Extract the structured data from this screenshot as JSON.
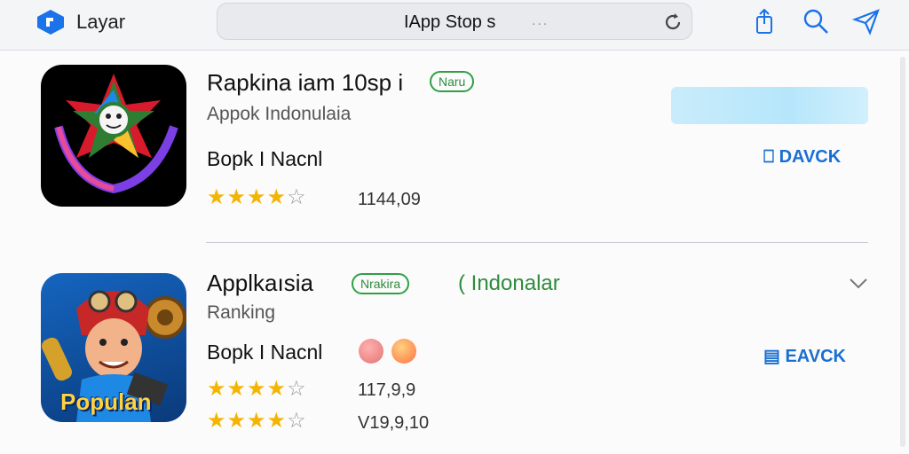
{
  "header": {
    "brand": "Layar",
    "address_title": "IApp Stop s",
    "address_dots": "...",
    "icons": [
      "layar-logo-icon",
      "reload-icon",
      "share-icon",
      "search-icon",
      "send-icon"
    ]
  },
  "apps": [
    {
      "name": "Rapkina iam 10sp i",
      "badge": "Naru",
      "subtitle": "Appok Indonulaia",
      "category": "Bopk I Nacnl",
      "rating_stars": 4,
      "rating_max": 5,
      "reviews": "1144,09",
      "action_label": "DAVCK"
    },
    {
      "name": "Applkaısia",
      "badge": "Nrakira",
      "developer": "( Indonalar",
      "subtitle": "Ranking",
      "category": "Bopk I Nacnl",
      "rating_stars": 4,
      "rating_max": 5,
      "reviews": "117,9,9",
      "rating2_stars": 4,
      "reviews2": "V19,9,10",
      "action_label": "EAVCK",
      "icon_text": "Populan",
      "emojis": [
        "face-emoji",
        "tongue-face-emoji"
      ]
    }
  ],
  "colors": {
    "accent": "#1a6fd1",
    "badge_green": "#2ea043",
    "star": "#f5b400"
  }
}
